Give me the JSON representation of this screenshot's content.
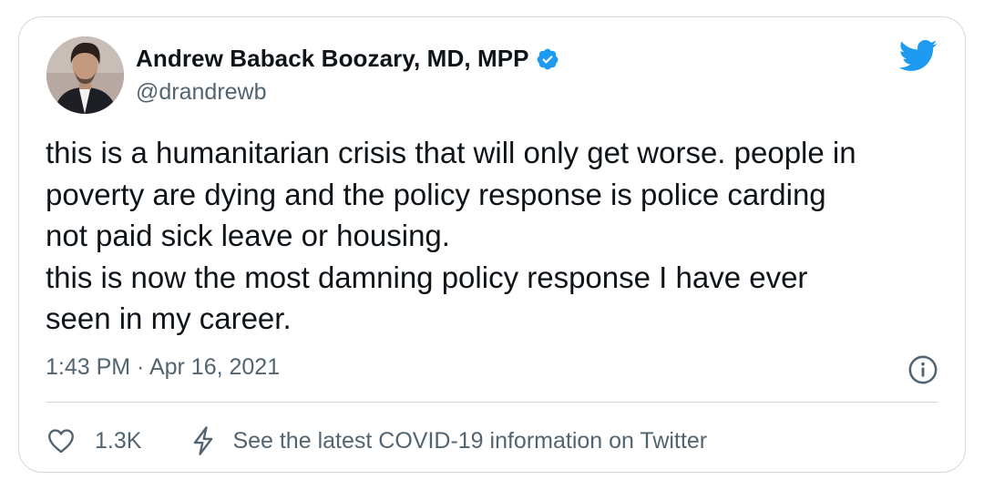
{
  "author": {
    "display_name": "Andrew Baback Boozary, MD, MPP",
    "handle": "@drandrewb",
    "verified": true,
    "avatar_icon": "profile-photo"
  },
  "tweet": {
    "lines": [
      "this is a humanitarian crisis that will only get worse. people in",
      "poverty are dying and the policy response is police carding",
      "not paid sick leave or housing.",
      "this is now the most damning policy response I have ever",
      "seen in my career."
    ],
    "timestamp": "1:43 PM · Apr 16, 2021"
  },
  "actions": {
    "like_count": "1.3K",
    "covid_link_label": "See the latest COVID-19 information on Twitter"
  },
  "icons": {
    "brand": "twitter-bird-icon",
    "verified": "verified-badge-icon",
    "info": "info-icon",
    "like": "heart-icon",
    "covid": "lightning-bolt-icon"
  },
  "colors": {
    "brand_blue": "#1d9bf0",
    "text_primary": "#0f1419",
    "text_secondary": "#536471",
    "border": "#cfd9de"
  }
}
